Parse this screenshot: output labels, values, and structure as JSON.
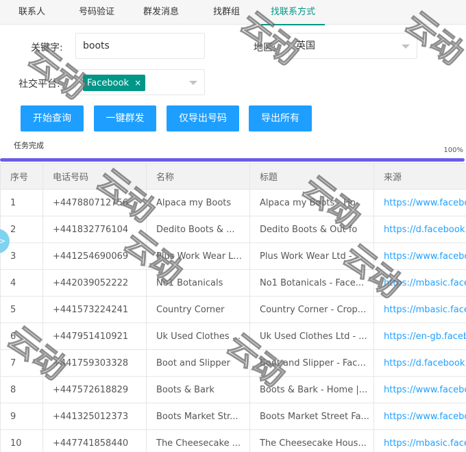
{
  "tabs": [
    {
      "label": "联系人"
    },
    {
      "label": "号码验证"
    },
    {
      "label": "群发消息"
    },
    {
      "label": "找群组"
    },
    {
      "label": "找联系方式"
    }
  ],
  "form": {
    "keyword_label": "关键字:",
    "keyword_value": "boots",
    "region_label": "地区:",
    "region_value": "英国",
    "platform_label": "社交平台:",
    "platform_chip": "Facebook",
    "chip_remove": "×"
  },
  "buttons": {
    "start": "开始查询",
    "broadcast": "一键群发",
    "export_phones": "仅导出号码",
    "export_all": "导出所有"
  },
  "status": {
    "text": "任务完成",
    "percent_label": "100%",
    "progress": 100
  },
  "table": {
    "headers": [
      "序号",
      "电话号码",
      "名称",
      "标题",
      "来源"
    ],
    "rows": [
      {
        "idx": "1",
        "phone": "+447880712756",
        "name": "Alpaca my Boots",
        "title": "Alpaca my Boots - Ho",
        "source": "https://www.facebook."
      },
      {
        "idx": "2",
        "phone": "+441832776104",
        "name": "Dedito Boots & ...",
        "title": "Dedito Boots & Out fo",
        "source": "https://d.facebook.com"
      },
      {
        "idx": "3",
        "phone": "+441254690069",
        "name": "Plus Work Wear L...",
        "title": "Plus Work Wear Ltd - ...",
        "source": "https://www.facebook."
      },
      {
        "idx": "4",
        "phone": "+442039052222",
        "name": "No1 Botanicals",
        "title": "No1 Botanicals - Face...",
        "source": "https://mbasic.facebook"
      },
      {
        "idx": "5",
        "phone": "+441573224241",
        "name": "Country Corner",
        "title": "Country Corner - Crop...",
        "source": "https://mbasic.facebook"
      },
      {
        "idx": "6",
        "phone": "+447951410921",
        "name": "Uk Used Clothes ...",
        "title": "Uk Used Clothes Ltd - ...",
        "source": "https://en-gb.facebook"
      },
      {
        "idx": "7",
        "phone": "+441759303328",
        "name": "Boot and Slipper",
        "title": "Boot and Slipper - Fac...",
        "source": "https://d.facebook.com"
      },
      {
        "idx": "8",
        "phone": "+447572618829",
        "name": "Boots & Bark",
        "title": "Boots & Bark - Home |...",
        "source": "https://www.facebook."
      },
      {
        "idx": "9",
        "phone": "+441325012373",
        "name": "Boots Market Str...",
        "title": "Boots Market Street Fa...",
        "source": "https://www.facebook."
      },
      {
        "idx": "10",
        "phone": "+447741858440",
        "name": "The Cheesecake ...",
        "title": "The Cheesecake Hous...",
        "source": "https://mbasic.facebook"
      }
    ]
  },
  "side_handle": ">",
  "watermarks": [
    {
      "text": "云动"
    },
    {
      "text": "云动"
    },
    {
      "text": "云动"
    },
    {
      "text": "云动"
    },
    {
      "text": "云动"
    },
    {
      "text": "云动"
    },
    {
      "text": "云动"
    },
    {
      "text": "云动"
    },
    {
      "text": "云动"
    }
  ],
  "colors": {
    "accent": "#009688",
    "button": "#1e9fff",
    "progress": "#6c5ce7",
    "link": "#1e9fff"
  }
}
